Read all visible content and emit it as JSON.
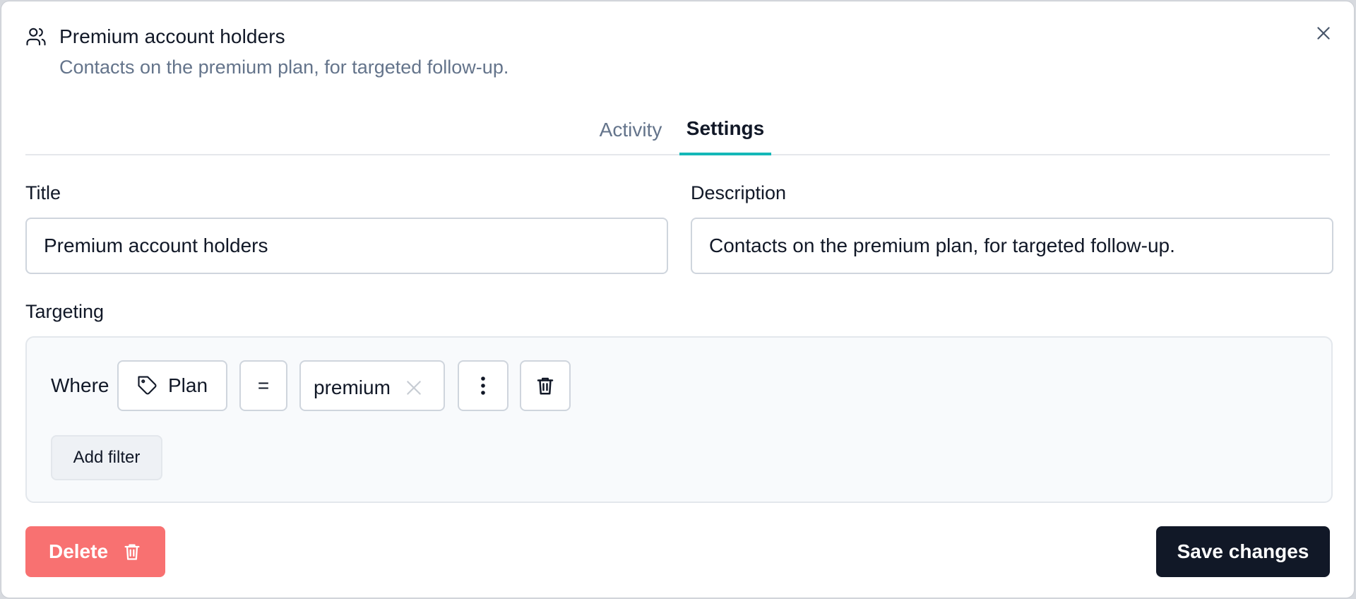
{
  "header": {
    "title": "Premium account holders",
    "subtitle": "Contacts on the premium plan, for targeted follow-up.",
    "icon": "users-icon",
    "close_icon": "close-icon"
  },
  "tabs": [
    {
      "label": "Activity",
      "active": false
    },
    {
      "label": "Settings",
      "active": true
    }
  ],
  "form": {
    "title_label": "Title",
    "title_value": "Premium account holders",
    "description_label": "Description",
    "description_value": "Contacts on the premium plan, for targeted follow-up."
  },
  "targeting": {
    "label": "Targeting",
    "filter": {
      "prefix": "Where",
      "field": "Plan",
      "field_icon": "tag-icon",
      "operator": "=",
      "value": "premium",
      "clear_icon": "close-icon",
      "more_icon": "more-vertical-icon",
      "remove_icon": "trash-icon"
    },
    "add_filter_label": "Add filter"
  },
  "footer": {
    "delete_label": "Delete",
    "delete_icon": "trash-icon",
    "save_label": "Save changes"
  },
  "colors": {
    "accent": "#14b8b8",
    "danger": "#f87171",
    "primary": "#111827",
    "muted": "#64748b"
  }
}
